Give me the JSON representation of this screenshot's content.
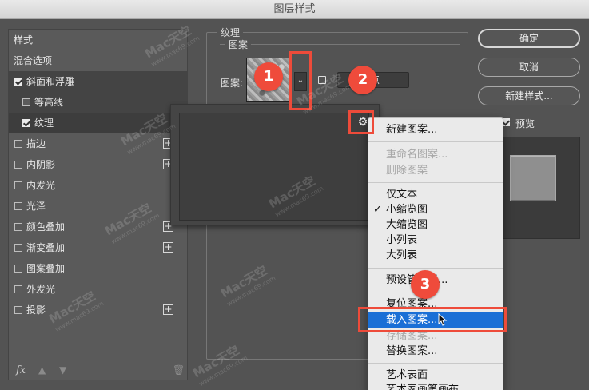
{
  "window": {
    "title": "图层样式"
  },
  "style_panel": {
    "header": "样式",
    "blend_options": "混合选项",
    "items": [
      {
        "label": "斜面和浮雕",
        "checked": true,
        "plus": false
      },
      {
        "label": "等高线",
        "checked": false,
        "plus": false
      },
      {
        "label": "纹理",
        "checked": true,
        "plus": false
      },
      {
        "label": "描边",
        "checked": false,
        "plus": true
      },
      {
        "label": "内阴影",
        "checked": false,
        "plus": true
      },
      {
        "label": "内发光",
        "checked": false,
        "plus": false
      },
      {
        "label": "光泽",
        "checked": false,
        "plus": false
      },
      {
        "label": "颜色叠加",
        "checked": false,
        "plus": true
      },
      {
        "label": "渐变叠加",
        "checked": false,
        "plus": true
      },
      {
        "label": "图案叠加",
        "checked": false,
        "plus": false
      },
      {
        "label": "外发光",
        "checked": false,
        "plus": false
      },
      {
        "label": "投影",
        "checked": false,
        "plus": true
      }
    ],
    "footer": {
      "fx": "fx"
    }
  },
  "texture": {
    "section_title": "纹理",
    "group_title": "图案",
    "pattern_label": "图案:",
    "origin_button": "点"
  },
  "menu": {
    "items": [
      {
        "label": "新建图案...",
        "disabled": false
      },
      {
        "label": "重命名图案...",
        "disabled": true
      },
      {
        "label": "删除图案",
        "disabled": true
      },
      {
        "label": "仅文本",
        "disabled": false
      },
      {
        "label": "小缩览图",
        "disabled": false,
        "checked": true
      },
      {
        "label": "大缩览图",
        "disabled": false
      },
      {
        "label": "小列表",
        "disabled": false
      },
      {
        "label": "大列表",
        "disabled": false
      },
      {
        "label": "预设管理器...",
        "disabled": false
      },
      {
        "label": "复位图案...",
        "disabled": false
      },
      {
        "label": "载入图案...",
        "disabled": false,
        "highlighted": true
      },
      {
        "label": "存储图案...",
        "disabled": true
      },
      {
        "label": "替换图案...",
        "disabled": false
      },
      {
        "label": "艺术表面",
        "disabled": false
      },
      {
        "label": "艺术家画笔画布",
        "disabled": false
      }
    ]
  },
  "buttons": {
    "ok": "确定",
    "cancel": "取消",
    "new_style": "新建样式..."
  },
  "preview": {
    "label": "预览",
    "checked": true
  },
  "callouts": [
    "1",
    "2",
    "3"
  ],
  "watermark": {
    "brand": "Mac天空",
    "url": "www.mac69.com"
  },
  "colors": {
    "accent_red": "#ee4b3a",
    "menu_highlight": "#1a6fd6"
  }
}
